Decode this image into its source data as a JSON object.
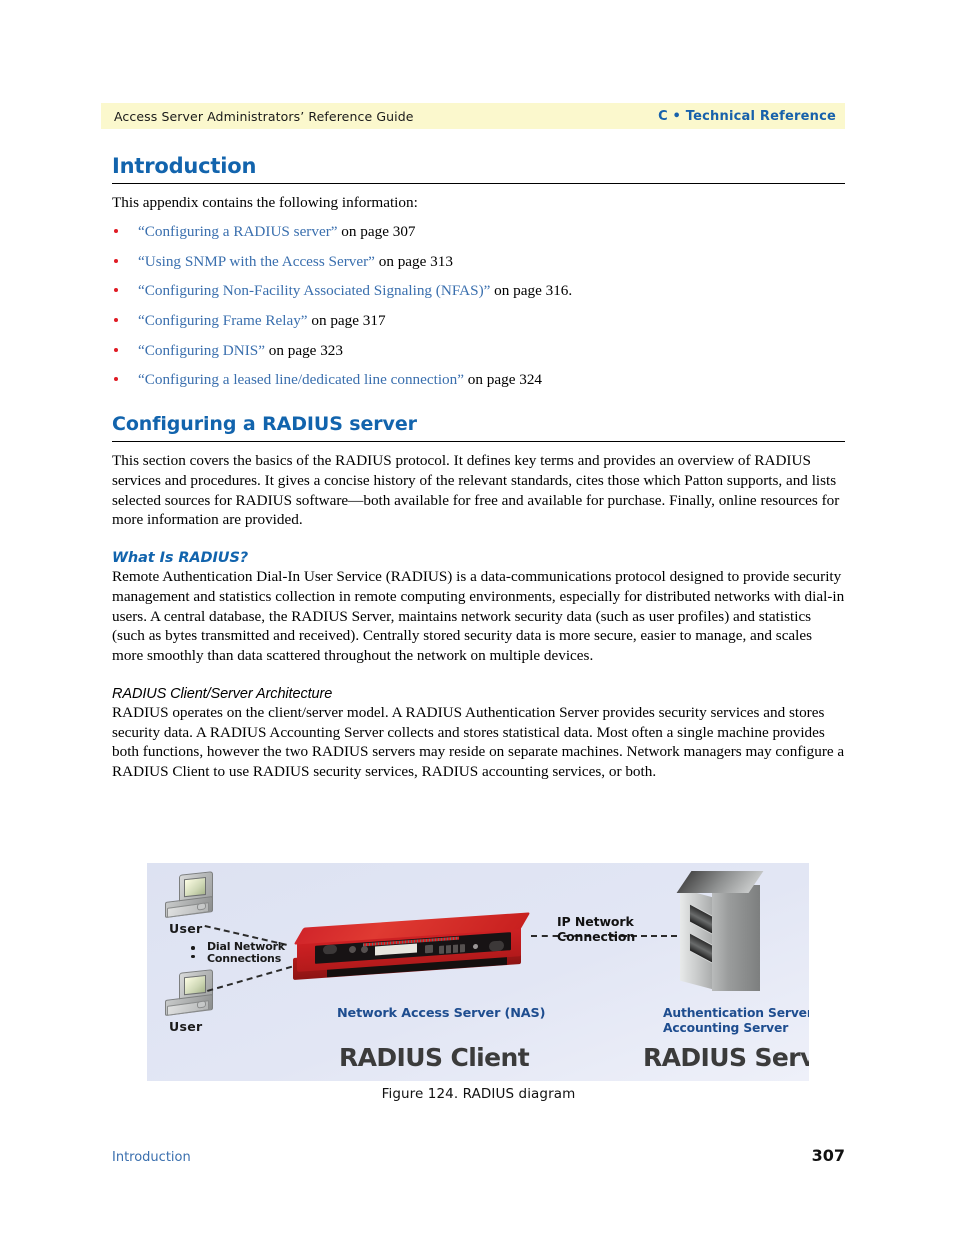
{
  "header": {
    "left": "Access Server Administrators’ Reference Guide",
    "right": "C • Technical Reference",
    "band_color": "#FBF8CD",
    "accent_blue": "#1264AD"
  },
  "intro": {
    "title": "Introduction",
    "lead": "This appendix contains the following information:",
    "links": [
      {
        "label": "“Configuring a RADIUS server”",
        "tail": " on page 307"
      },
      {
        "label": "“Using SNMP with the Access Server”",
        "tail": " on page 313"
      },
      {
        "label": "“Configuring Non-Facility Associated Signaling (NFAS)”",
        "tail": " on page 316."
      },
      {
        "label": "“Configuring Frame Relay”",
        "tail": " on page 317"
      },
      {
        "label": "“Configuring DNIS”",
        "tail": " on page 323"
      },
      {
        "label": "“Configuring a leased line/dedicated line connection”",
        "tail": " on page 324"
      }
    ]
  },
  "radius_section": {
    "title": "Configuring a RADIUS server",
    "intro_paragraph": "This section covers the basics of the RADIUS protocol. It defines key terms and provides an overview of RADIUS services and procedures. It gives a concise history of the relevant standards, cites those which Patton supports, and lists selected sources for RADIUS software—both available for free and available for purchase. Finally, online resources for more information are provided.",
    "what_is": {
      "heading": "What Is RADIUS?",
      "paragraph": "Remote Authentication Dial-In User Service (RADIUS) is a data-communications protocol designed to provide security management and statistics collection in remote computing environments, especially for distributed networks with dial-in users. A central database, the RADIUS Server, maintains network security data (such as user profiles) and statistics (such as bytes transmitted and received). Centrally stored security data is more secure, easier to manage, and scales more smoothly than data scattered throughout the network on multiple devices."
    },
    "architecture": {
      "heading": "RADIUS Client/Server Architecture",
      "paragraph": "RADIUS operates on the client/server model. A RADIUS Authentication Server provides security services and stores security data. A RADIUS Accounting Server collects and stores statistical data. Most often a single machine provides both functions, however the two RADIUS servers may reside on separate machines. Network managers may configure a RADIUS Client to use RADIUS security services, RADIUS accounting services, or both."
    }
  },
  "figure": {
    "caption": "Figure 124. RADIUS diagram",
    "background_color": "#DEE2F2",
    "labels": {
      "user_top": "User",
      "user_bottom": "User",
      "dial_line1": "Dial Network",
      "dial_line2": "Connections",
      "ip_line1": "IP Network",
      "ip_line2": "Connection",
      "nas": "Network Access Server (NAS)",
      "auth_line1": "Authentication Server",
      "auth_line2": "Accounting Server",
      "radius_client": "RADIUS Client",
      "radius_server": "RADIUS Server"
    },
    "icons": {
      "user_top": "workstation-icon",
      "user_bottom": "workstation-icon",
      "nas_device": "rackmount-router-icon",
      "server": "server-tower-icon"
    }
  },
  "footer": {
    "left": "Introduction",
    "page_number": "307"
  }
}
